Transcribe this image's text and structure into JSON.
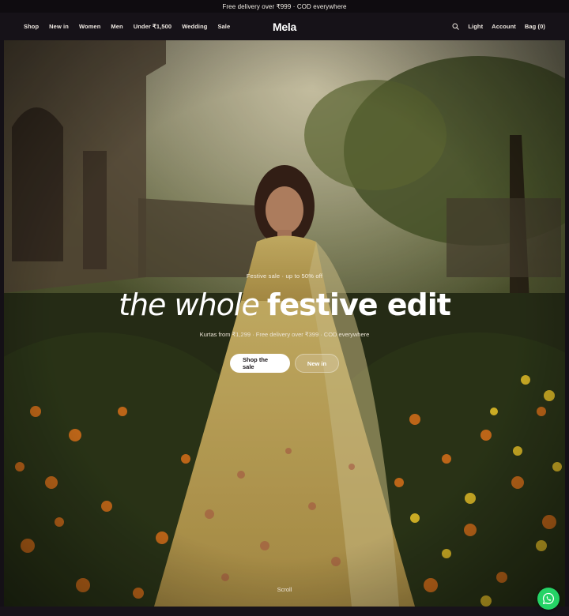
{
  "announcement": {
    "text": "Free delivery over ₹999 · COD everywhere"
  },
  "nav": {
    "left_links": [
      {
        "label": "Shop"
      },
      {
        "label": "New in"
      },
      {
        "label": "Women"
      },
      {
        "label": "Men"
      },
      {
        "label": "Under ₹1,500"
      },
      {
        "label": "Wedding"
      },
      {
        "label": "Sale"
      }
    ],
    "logo": "Mela",
    "search_icon": "search-icon",
    "theme_label": "Light",
    "account_label": "Account",
    "bag_label": "Bag (0)"
  },
  "hero": {
    "eyebrow": "Festive sale · up to 50% off",
    "headline_italic": "the whole",
    "headline_bold": "festive edit",
    "subline": "Kurtas from ₹1,299 · Free delivery over ₹399 · COD everywhere",
    "primary_cta": "Shop the sale",
    "secondary_cta": "New in",
    "scroll_label": "Scroll"
  },
  "floating": {
    "whatsapp_icon": "whatsapp-icon"
  },
  "colors": {
    "page_bg": "#141016",
    "nav_bg": "#161218",
    "whatsapp": "#25d366",
    "button_primary": "#ffffff"
  }
}
